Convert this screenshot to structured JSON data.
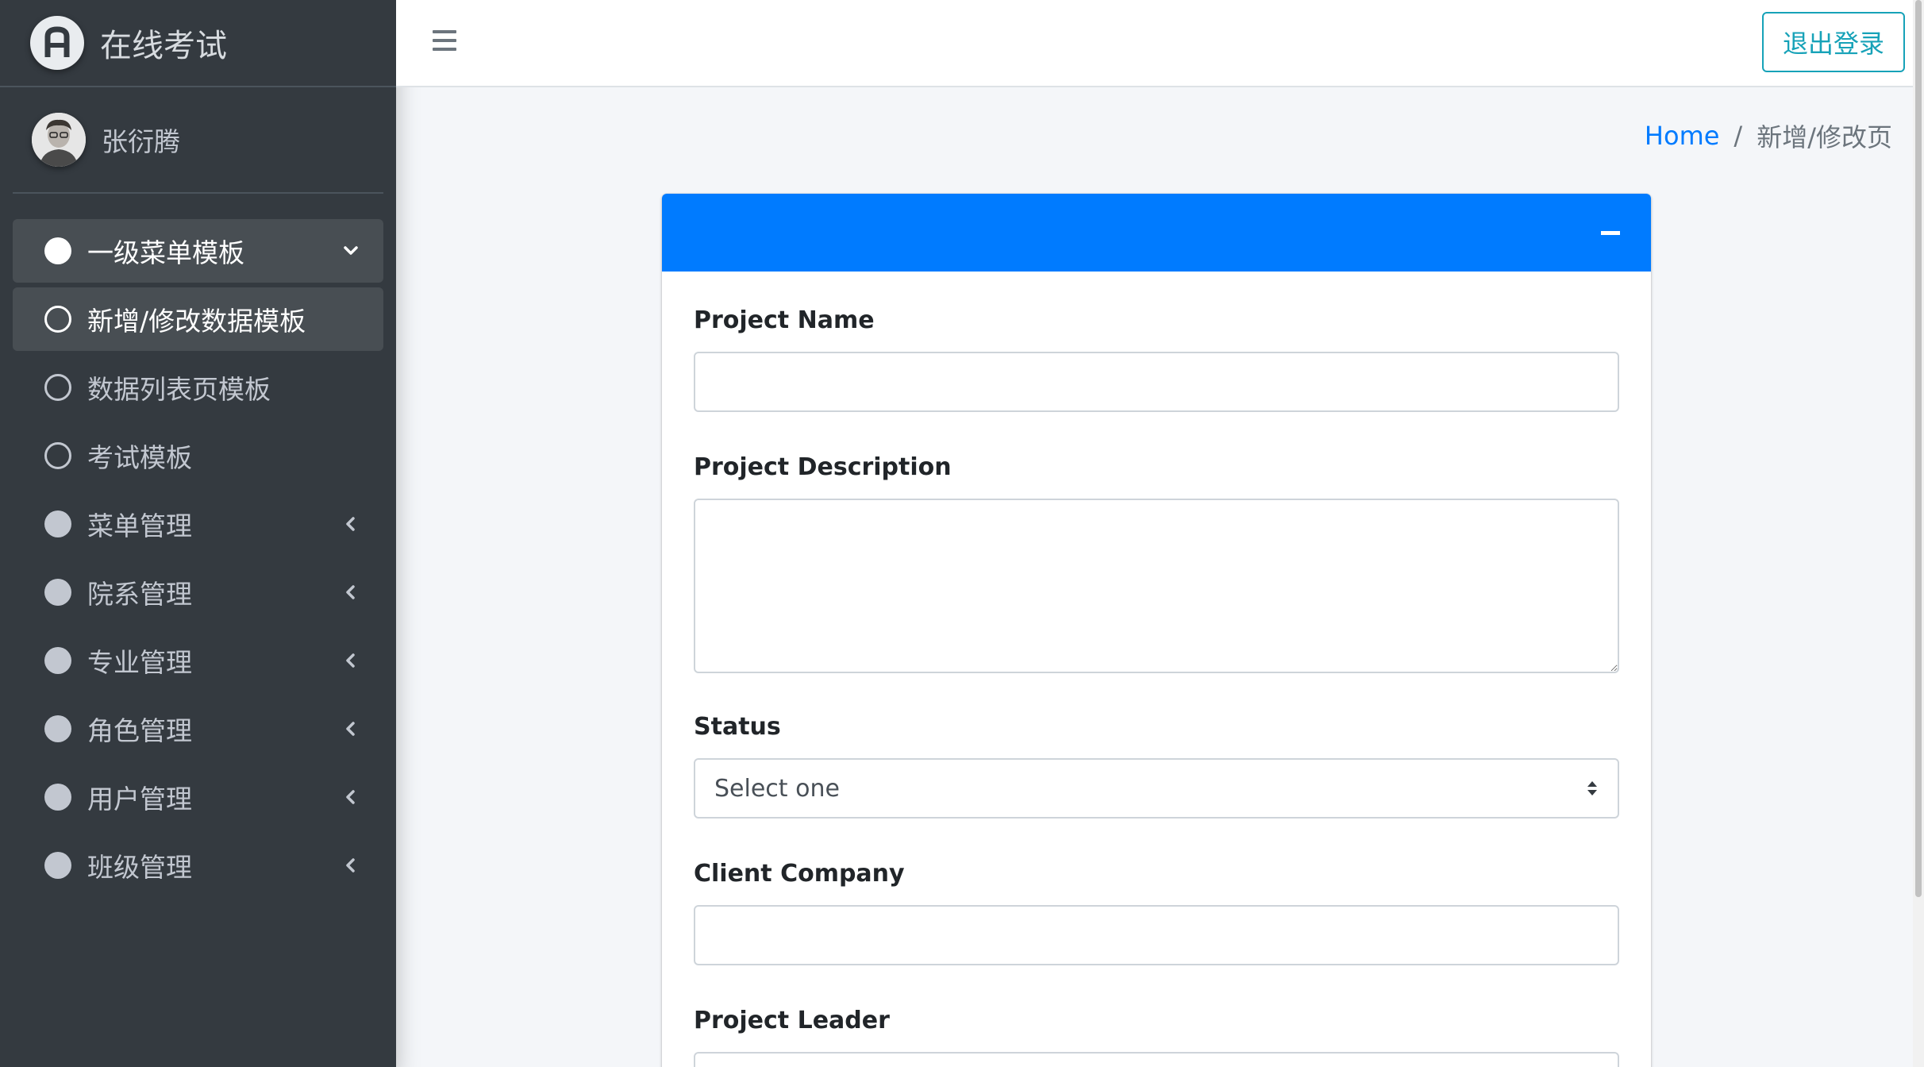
{
  "brand": {
    "title": "在线考试",
    "logo_icon": "a-letter-logo-icon"
  },
  "user": {
    "name": "张衍腾"
  },
  "sidebar": {
    "items": [
      {
        "label": "一级菜单模板",
        "state": "open",
        "icon": "circle-filled",
        "caret": "chevron-down"
      },
      {
        "label": "新增/修改数据模板",
        "state": "active",
        "icon": "circle-outline"
      },
      {
        "label": "数据列表页模板",
        "state": "normal",
        "icon": "circle-outline"
      },
      {
        "label": "考试模板",
        "state": "normal",
        "icon": "circle-outline"
      },
      {
        "label": "菜单管理",
        "state": "normal",
        "icon": "circle-filled",
        "caret": "chevron-left"
      },
      {
        "label": "院系管理",
        "state": "normal",
        "icon": "circle-filled",
        "caret": "chevron-left"
      },
      {
        "label": "专业管理",
        "state": "normal",
        "icon": "circle-filled",
        "caret": "chevron-left"
      },
      {
        "label": "角色管理",
        "state": "normal",
        "icon": "circle-filled",
        "caret": "chevron-left"
      },
      {
        "label": "用户管理",
        "state": "normal",
        "icon": "circle-filled",
        "caret": "chevron-left"
      },
      {
        "label": "班级管理",
        "state": "normal",
        "icon": "circle-filled",
        "caret": "chevron-left"
      }
    ]
  },
  "topbar": {
    "menu_icon": "hamburger-icon",
    "logout_label": "退出登录"
  },
  "breadcrumb": {
    "home": "Home",
    "separator": "/",
    "current": "新增/修改页"
  },
  "card": {
    "header_color": "#007bff",
    "collapse_icon": "minus-icon",
    "fields": {
      "project_name": {
        "label": "Project Name",
        "value": ""
      },
      "project_description": {
        "label": "Project Description",
        "value": ""
      },
      "status": {
        "label": "Status",
        "selected": "Select one"
      },
      "client_company": {
        "label": "Client Company",
        "value": ""
      },
      "project_leader": {
        "label": "Project Leader",
        "value": ""
      }
    }
  },
  "colors": {
    "sidebar_bg": "#343a40",
    "primary": "#007bff",
    "info": "#17a2b8",
    "page_bg": "#f4f6f9"
  }
}
